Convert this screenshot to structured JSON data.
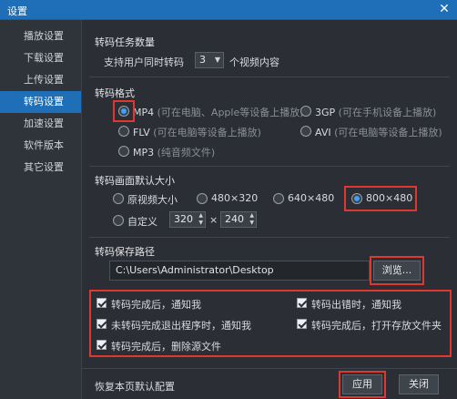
{
  "window": {
    "title": "设置",
    "close_glyph": "✕"
  },
  "sidebar": {
    "items": [
      {
        "label": "播放设置"
      },
      {
        "label": "下载设置"
      },
      {
        "label": "上传设置"
      },
      {
        "label": "转码设置",
        "active": true
      },
      {
        "label": "加速设置"
      },
      {
        "label": "软件版本"
      },
      {
        "label": "其它设置"
      }
    ]
  },
  "task_count": {
    "title": "转码任务数量",
    "prefix": "支持用户同时转码",
    "value": "3",
    "suffix": "个视频内容"
  },
  "format": {
    "title": "转码格式",
    "options": [
      {
        "name": "MP4",
        "hint": "(可在电脑、Apple等设备上播放)",
        "selected": true
      },
      {
        "name": "3GP",
        "hint": "(可在手机设备上播放)"
      },
      {
        "name": "FLV",
        "hint": "(可在电脑等设备上播放)"
      },
      {
        "name": "AVI",
        "hint": "(可在电脑等设备上播放)"
      },
      {
        "name": "MP3",
        "hint": "(纯音频文件)"
      }
    ]
  },
  "size": {
    "title": "转码画面默认大小",
    "options": [
      {
        "label": "原视频大小"
      },
      {
        "label": "480×320"
      },
      {
        "label": "640×480"
      },
      {
        "label": "800×480",
        "selected": true
      }
    ],
    "custom_label": "自定义",
    "width": "320",
    "times": "×",
    "height": "240"
  },
  "save_path": {
    "title": "转码保存路径",
    "value": "C:\\Users\\Administrator\\Desktop",
    "browse_label": "浏览..."
  },
  "checkboxes": [
    {
      "label": "转码完成后，通知我"
    },
    {
      "label": "转码出错时，通知我"
    },
    {
      "label": "未转码完成退出程序时，通知我"
    },
    {
      "label": "转码完成后，打开存放文件夹"
    },
    {
      "label": "转码完成后，删除源文件"
    }
  ],
  "footer": {
    "restore_label": "恢复本页默认配置",
    "apply_label": "应用",
    "close_label": "关闭"
  },
  "colors": {
    "accent": "#1e6fb8",
    "highlight": "#e0372f",
    "radio_on": "#3da2ff"
  }
}
